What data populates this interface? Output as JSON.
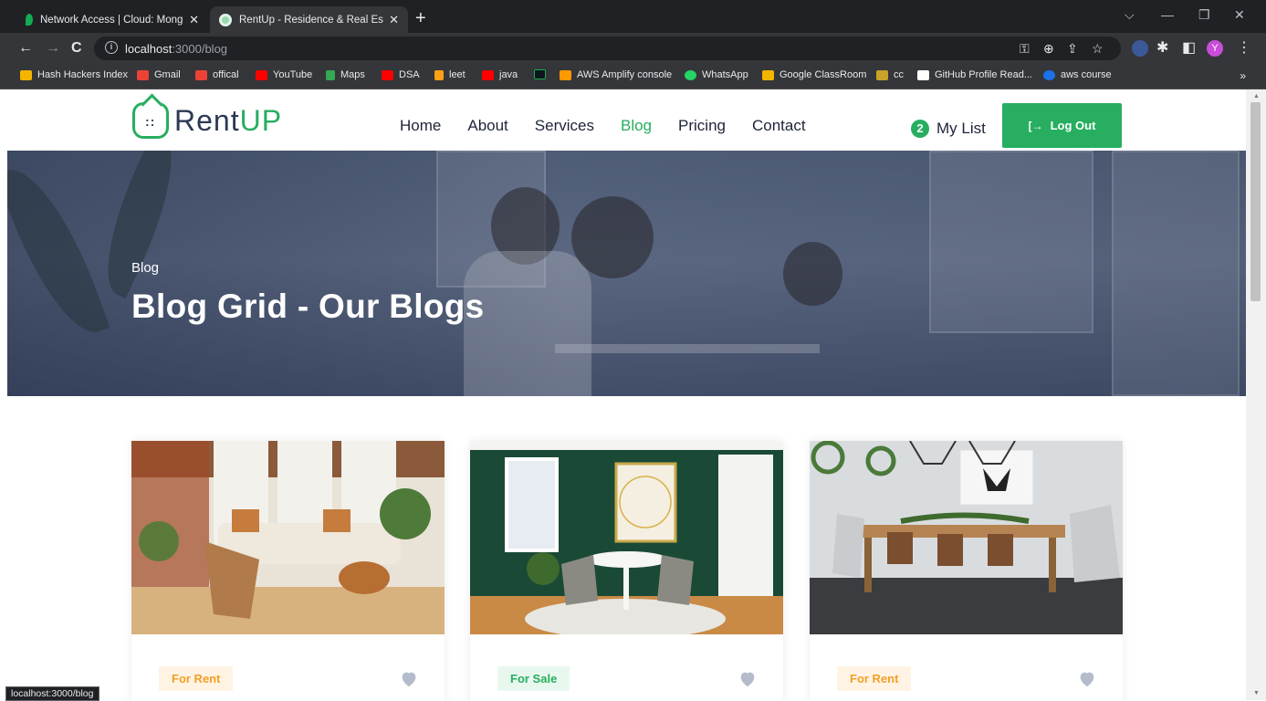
{
  "browser": {
    "tabs": [
      {
        "title": "Network Access | Cloud: MongoD",
        "active": false,
        "color": "#13aa52"
      },
      {
        "title": "RentUp - Residence & Real Estate",
        "active": true,
        "color": "#9ad7b0"
      }
    ],
    "url_host": "localhost",
    "url_path": ":3000/blog",
    "bookmarks": [
      {
        "label": "Hash Hackers Index",
        "color": "#f4b400"
      },
      {
        "label": "Gmail",
        "color": "#ea4335"
      },
      {
        "label": "offical",
        "color": "#ea4335"
      },
      {
        "label": "YouTube",
        "color": "#ff0000"
      },
      {
        "label": "Maps",
        "color": "#34a853"
      },
      {
        "label": "DSA",
        "color": "#ff0000"
      },
      {
        "label": "leet",
        "color": "#ffa116"
      },
      {
        "label": "java",
        "color": "#ff0000"
      },
      {
        "label": "AWS Amplify console",
        "color": "#ff9900"
      },
      {
        "label": "WhatsApp",
        "color": "#25d366"
      },
      {
        "label": "Google ClassRoom",
        "color": "#f4b400"
      },
      {
        "label": "cc",
        "color": "#c9a227"
      },
      {
        "label": "GitHub Profile Read...",
        "color": "#ffffff"
      },
      {
        "label": "aws course",
        "color": "#1a73e8"
      }
    ],
    "profile_initial": "Y",
    "status_url": "localhost:3000/blog"
  },
  "site": {
    "logo_part1": "Rent",
    "logo_part2": "UP",
    "nav": [
      "Home",
      "About",
      "Services",
      "Blog",
      "Pricing",
      "Contact"
    ],
    "active_nav": "Blog",
    "mylist_count": "2",
    "mylist_label": "My List",
    "logout_label": "Log Out"
  },
  "hero": {
    "subtitle": "Blog",
    "title": "Blog Grid - Our Blogs"
  },
  "cards": [
    {
      "tag": "For Rent",
      "type": "rent"
    },
    {
      "tag": "For Sale",
      "type": "sale"
    },
    {
      "tag": "For Rent",
      "type": "rent"
    }
  ],
  "colors": {
    "accent": "#27ae60",
    "rent": "#f59e28",
    "text_dark": "#1d2438"
  }
}
